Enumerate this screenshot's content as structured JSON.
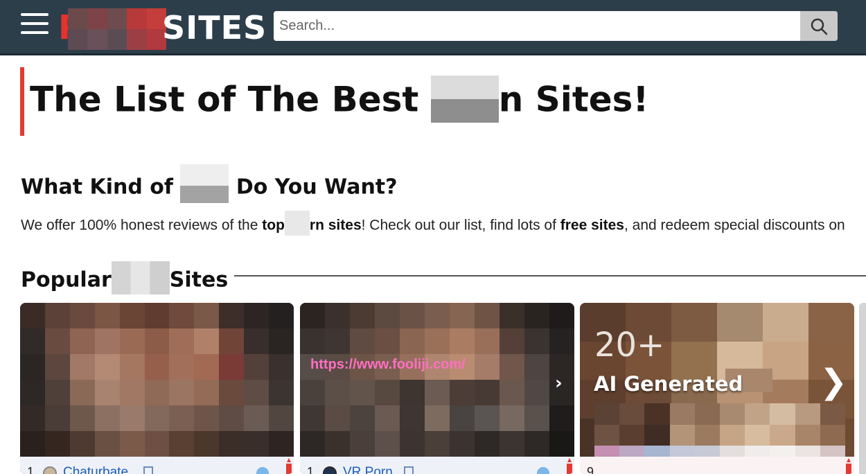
{
  "header": {
    "logo_prefix": "P",
    "logo_suffix": "SITES",
    "search_placeholder": "Search...",
    "menu_icon": "hamburger-icon",
    "search_icon": "search-icon"
  },
  "main": {
    "title_start": "The List of The Best ",
    "title_end": "n Sites!",
    "kind_start": "What Kind of ",
    "kind_end": " Do You Want?",
    "intro_1": "We offer 100% honest reviews of the ",
    "intro_bold_1": "top",
    "intro_bold_2": "rn sites",
    "intro_2": "! Check out our list, find lots of ",
    "intro_bold_3": "free sites",
    "intro_3": ", and redeem special discounts on",
    "popular_start": "Popular",
    "popular_end": "Sites"
  },
  "cards": [
    {
      "rank": "1",
      "name": "Chaturbate"
    },
    {
      "rank": "1",
      "name": "VR Porn"
    },
    {
      "count": "20+",
      "label": "AI Generated",
      "rank": "9"
    }
  ],
  "watermark": "https://www.fooliji.com/",
  "colors": {
    "header_bg": "#2d3e4b",
    "accent_red": "#e23b33",
    "link_blue": "#1d5fb8",
    "watermark_pink": "#ff6fc2"
  }
}
